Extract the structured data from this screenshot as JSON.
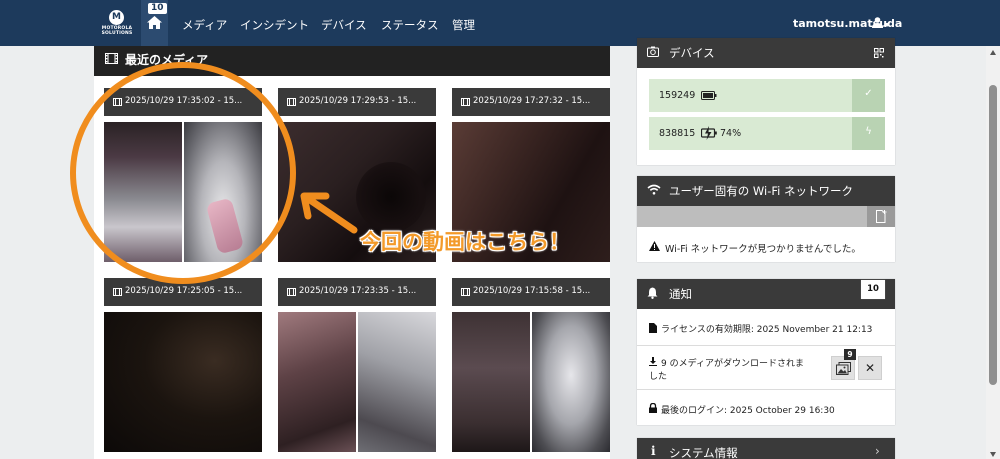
{
  "nav": {
    "logo_text": "MOTOROLA SOLUTIONS",
    "logo_letter": "M",
    "home_badge": "10",
    "items": [
      "メディア",
      "インシデント",
      "デバイス",
      "ステータス",
      "管理"
    ],
    "user": "tamotsu.matsuda"
  },
  "media": {
    "title": "最近のメディア",
    "tiles": [
      {
        "label": "2025/10/29 17:35:02 - 15...",
        "thumb": "split"
      },
      {
        "label": "2025/10/29 17:29:53 - 15...",
        "thumb": "dark"
      },
      {
        "label": "2025/10/29 17:27:32 - 15...",
        "thumb": "dark2"
      },
      {
        "label": "2025/10/29 17:25:05 - 15...",
        "thumb": "black"
      },
      {
        "label": "2025/10/29 17:23:35 - 15...",
        "thumb": "split"
      },
      {
        "label": "2025/10/29 17:15:58 - 15...",
        "thumb": "split"
      }
    ]
  },
  "annotation": {
    "text": "今回の動画はこちら！",
    "color": "#f08d1e"
  },
  "devices": {
    "title": "デバイス",
    "rows": [
      {
        "id": "159249",
        "battery_text": "",
        "action": "check"
      },
      {
        "id": "838815",
        "battery_text": "74%",
        "action": "bolt"
      }
    ]
  },
  "wifi": {
    "title": "ユーザー固有の Wi-Fi ネットワーク",
    "message": "Wi-Fi ネットワークが見つかりませんでした。"
  },
  "notifications": {
    "title": "通知",
    "count": "10",
    "license": "ライセンスの有効期限: 2025 November 21 12:13",
    "download_line1": "9 のメディアがダウンロードされま",
    "download_line2": "した",
    "download_badge": "9",
    "last_login": "最後のログイン: 2025 October 29 16:30"
  },
  "system": {
    "title": "システム情報"
  },
  "colors": {
    "nav_bg": "#1d3a5c",
    "accent_orange": "#f08d1e",
    "device_row_bg": "#d9ead3"
  }
}
